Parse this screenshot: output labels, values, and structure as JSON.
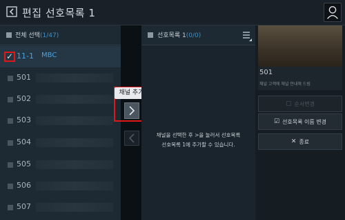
{
  "title": "편집 선호목록 1",
  "left": {
    "header_label": "전체 선택",
    "header_count": "(1/47)",
    "selected": {
      "number": "11-1",
      "name": "MBC"
    },
    "rows": [
      "501",
      "502",
      "503",
      "504",
      "505",
      "506",
      "507"
    ]
  },
  "middle": {
    "tooltip": "채널 추가",
    "add_icon": "chevron-right-icon",
    "remove_icon": "chevron-left-icon"
  },
  "favorites": {
    "header_label": "선호목록 1",
    "header_count": "(0/0)",
    "empty_line1": "채널을 선택한 후 >을 눌러서 선호목록",
    "empty_line2": "선호목록 1에 추가할 수 있습니다."
  },
  "right": {
    "preview_channel": "501",
    "preview_desc": "채널 고객에 채널 안내해 드림",
    "buttons": {
      "order_change": "순서변경",
      "rename": "선호목록 이름 변경",
      "close": "종료"
    }
  },
  "colors": {
    "highlight": "#e01818",
    "accent": "#4aa3e0"
  }
}
